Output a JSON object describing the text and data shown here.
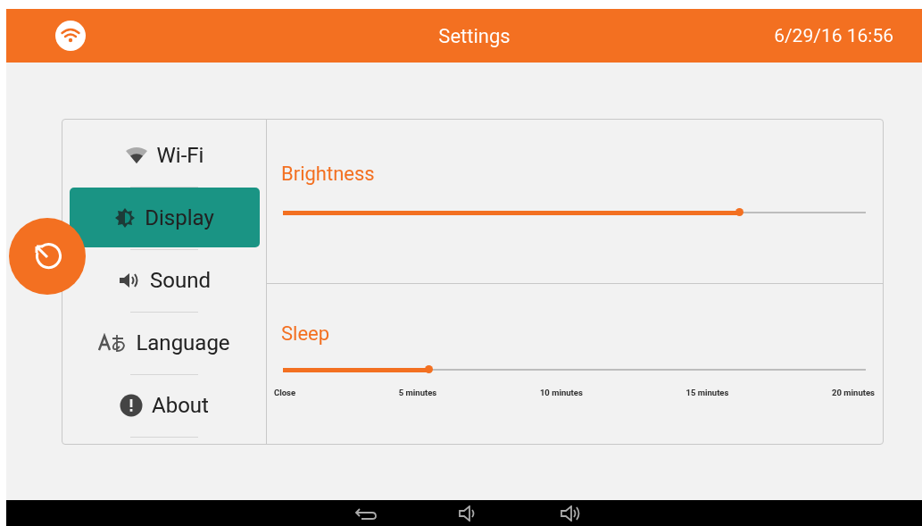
{
  "header": {
    "title": "Settings",
    "datetime": "6/29/16 16:56"
  },
  "sidebar": {
    "items": [
      {
        "label": "Wi-Fi",
        "selected": false
      },
      {
        "label": "Display",
        "selected": true
      },
      {
        "label": "Sound",
        "selected": false
      },
      {
        "label": "Language",
        "selected": false
      },
      {
        "label": "About",
        "selected": false
      }
    ]
  },
  "brightness": {
    "label": "Brightness",
    "level": 0.784
  },
  "sleep": {
    "label": "Sleep",
    "level": 0.251,
    "ticks": [
      "Close",
      "5 minutes",
      "10 minutes",
      "15 minutes",
      "20 minutes"
    ]
  }
}
